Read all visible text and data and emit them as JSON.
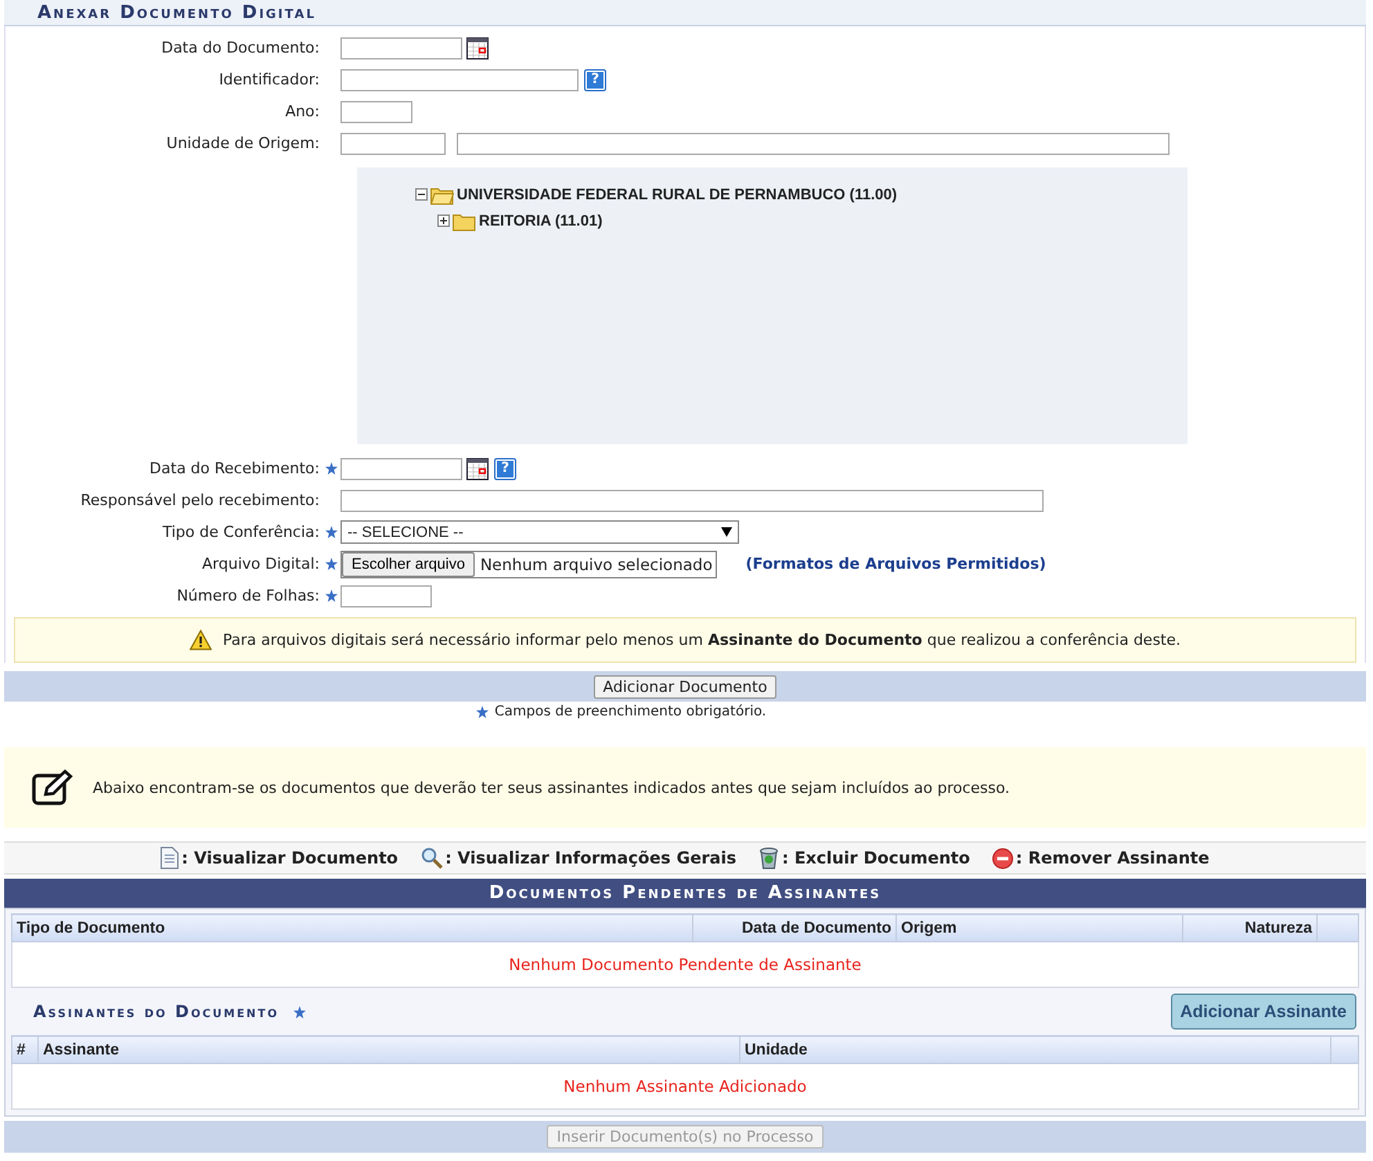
{
  "form": {
    "title": "Anexar Documento Digital",
    "fields": [
      {
        "kind": "date",
        "label": "Data do Documento:",
        "required": false
      },
      {
        "kind": "text",
        "label": "Identificador:",
        "required": false,
        "help": "?"
      },
      {
        "kind": "year",
        "label": "Ano:",
        "required": false
      },
      {
        "kind": "unit",
        "label": "Unidade de Origem:",
        "required": false
      },
      {
        "kind": "tree",
        "nodes": [
          {
            "label": "UNIVERSIDADE FEDERAL RURAL DE PERNAMBUCO (11.00)",
            "expanded": true,
            "children": [
              {
                "label": "REITORIA (11.01)",
                "expanded": false
              }
            ]
          }
        ]
      },
      {
        "kind": "date",
        "label": "Data do Recebimento:",
        "required": true,
        "help": "?"
      },
      {
        "kind": "long-text",
        "label": "Responsável pelo recebimento:",
        "required": false
      },
      {
        "kind": "select",
        "label": "Tipo de Conferência:",
        "required": true,
        "value": "-- SELECIONE --"
      },
      {
        "kind": "file",
        "label": "Arquivo Digital:",
        "required": true,
        "button": "Escolher arquivo",
        "status": "Nenhum arquivo selecionado",
        "link": "(Formatos de Arquivos Permitidos)"
      },
      {
        "kind": "number",
        "label": "Número de Folhas:",
        "required": true
      }
    ],
    "notice": "Para arquivos digitais será necessário informar pelo menos um **Assinante do Documento** que realizou a conferência deste.",
    "submit": "Adicionar Documento",
    "required_note": "Campos de preenchimento obrigatório."
  },
  "info": "Abaixo encontram-se os documentos que deverão ter seus assinantes indicados antes que sejam incluídos ao processo.",
  "legend": [
    {
      "kind": "view",
      "label": ": Visualizar Documento"
    },
    {
      "kind": "search",
      "label": ": Visualizar Informações Gerais"
    },
    {
      "kind": "delete",
      "label": ": Excluir Documento"
    },
    {
      "kind": "remove",
      "label": ": Remover Assinante"
    }
  ],
  "pending": {
    "title": "Documentos Pendentes de Assinantes",
    "columns": [
      "Tipo de Documento",
      "Data de Documento",
      "Origem",
      "Natureza"
    ],
    "empty": "Nenhum Documento Pendente de Assinante"
  },
  "signers": {
    "title": "Assinantes do Documento",
    "required": true,
    "button": "Adicionar Assinante",
    "columns": [
      "#",
      "Assinante",
      "Unidade"
    ],
    "empty": "Nenhum Assinante Adicionado"
  },
  "final_button": {
    "label": "Inserir Documento(s) no Processo",
    "disabled": true
  }
}
